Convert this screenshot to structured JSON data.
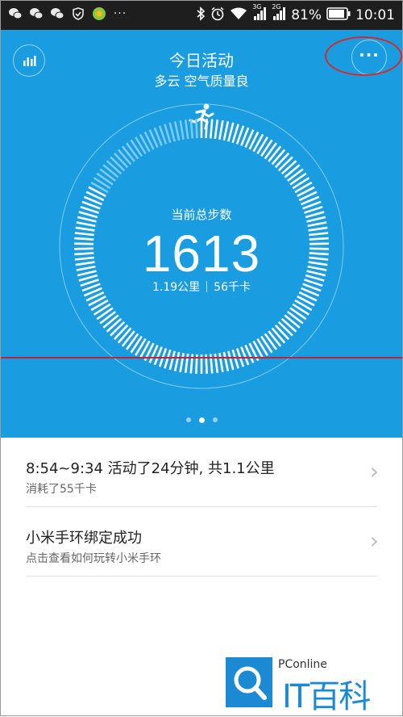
{
  "status_bar": {
    "left_icons": [
      "wechat-icon",
      "wechat-icon",
      "wechat-icon",
      "shield-check-icon",
      "app-icon",
      "more-icon"
    ],
    "network_3g": "3G",
    "network_2g": "2G",
    "battery": "81%",
    "time": "10:01"
  },
  "header": {
    "title": "今日活动",
    "subtitle": "多云 空气质量良",
    "more_label": "···"
  },
  "activity": {
    "center_label": "当前总步数",
    "steps": "1613",
    "distance": "1.19公里",
    "calories": "56千卡",
    "progress_fraction": 0.83,
    "page_count": 3,
    "active_page": 2
  },
  "list": {
    "items": [
      {
        "title": "8:54~9:34 活动了24分钟, 共1.1公里",
        "subtitle": "消耗了55千卡"
      },
      {
        "title": "小米手环绑定成功",
        "subtitle": "点击查看如何玩转小米手环"
      }
    ]
  },
  "watermark": {
    "brand": "PConline",
    "name": "IT百科"
  },
  "colors": {
    "hero_bg": "#1a9de0",
    "ring_faded": "#7ccaf0",
    "annotation_red": "#d62a2a"
  }
}
